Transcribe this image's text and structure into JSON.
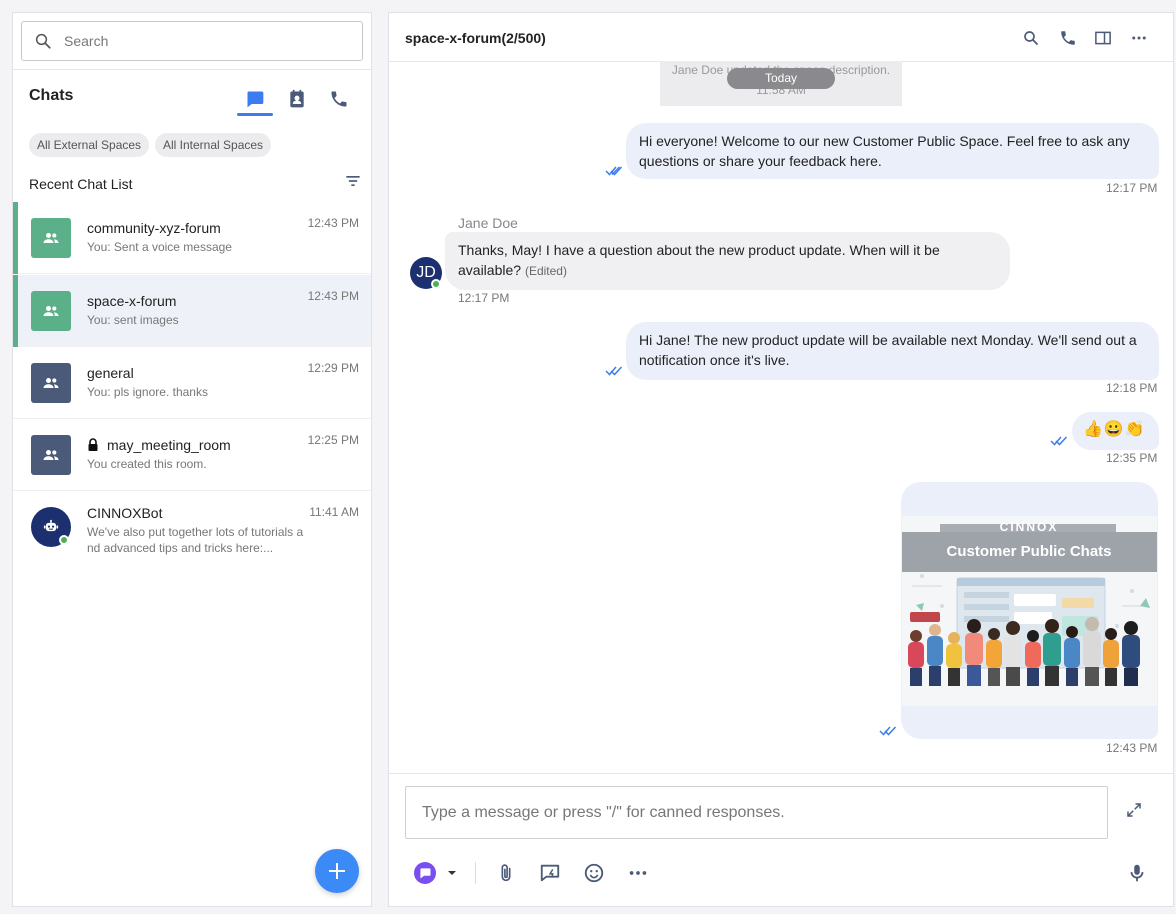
{
  "colors": {
    "accent": "#3c7cf0",
    "space_green": "#5bb08a",
    "space_slate": "#4a5a78",
    "bot_navy": "#1c2f6e",
    "online": "#4caf50",
    "outgoing_bubble": "#ebeffa",
    "incoming_bubble": "#f0f0f2"
  },
  "sidebar": {
    "search": {
      "placeholder": "Search",
      "icon": "search-icon"
    },
    "title": "Chats",
    "header_tabs": [
      {
        "icon": "chat-bubble-icon",
        "active": true
      },
      {
        "icon": "contacts-icon",
        "active": false
      },
      {
        "icon": "phone-icon",
        "active": false
      }
    ],
    "filters": [
      "All External Spaces",
      "All Internal Spaces"
    ],
    "recent_label": "Recent Chat List",
    "filter_icon": "filter-icon",
    "chats": [
      {
        "name": "community-xyz-forum",
        "preview": "You:  Sent a voice message",
        "time": "12:43 PM",
        "icon": "group-icon",
        "active": false
      },
      {
        "name": "space-x-forum",
        "preview": "You:  sent images",
        "time": "12:43 PM",
        "icon": "group-icon",
        "active": true
      },
      {
        "name": "general",
        "preview": "You: pls ignore. thanks",
        "time": "12:29 PM",
        "icon": "group-icon",
        "active": false
      },
      {
        "name": "may_meeting_room",
        "preview": "You created this room.",
        "time": "12:25 PM",
        "icon": "group-icon",
        "locked": true,
        "active": false
      },
      {
        "name": "CINNOXBot",
        "preview_line1": "We've also put together lots of tutorials a",
        "preview_line2": "nd advanced tips and tricks here:...",
        "time": "11:41 AM",
        "icon": "bot-icon",
        "online": true,
        "active": false
      }
    ],
    "fab_icon": "plus-icon"
  },
  "conversation": {
    "title": "space-x-forum(2/500)",
    "toolbar_icons": [
      "search-icon",
      "phone-icon",
      "split-view-icon",
      "more-icon"
    ],
    "system_event": {
      "text": "Jane Doe updated the space description.",
      "time": "11:58 AM",
      "date_divider": "Today"
    },
    "messages": [
      {
        "direction": "out",
        "text": "Hi everyone! Welcome to our new Customer Public Space. Feel free to ask any questions or share your feedback here.",
        "time": "12:17 PM",
        "read": true
      },
      {
        "direction": "in",
        "sender": "Jane Doe",
        "initials": "JD",
        "text": "Thanks, May! I have a question about the new product update. When will it be available?",
        "edited_tag": "(Edited)",
        "time": "12:17 PM"
      },
      {
        "direction": "out",
        "text": "Hi Jane! The new product update will be available next Monday. We'll send out a notification once it's live.",
        "time": "12:18 PM",
        "read": true
      },
      {
        "direction": "out",
        "text": "👍😀👏",
        "time": "12:35 PM",
        "read": true
      },
      {
        "direction": "out",
        "type": "image",
        "image": {
          "brand": "CINNOX",
          "title": "Customer Public Chats"
        },
        "time": "12:43 PM",
        "read": true
      }
    ]
  },
  "composer": {
    "placeholder": "Type a message or press \"/\" for canned responses.",
    "expand_icon": "expand-icon",
    "tools": [
      "channel-selector-icon",
      "caret-down-icon",
      "attachment-icon",
      "canned-response-icon",
      "emoji-icon",
      "more-icon",
      "microphone-icon"
    ]
  }
}
